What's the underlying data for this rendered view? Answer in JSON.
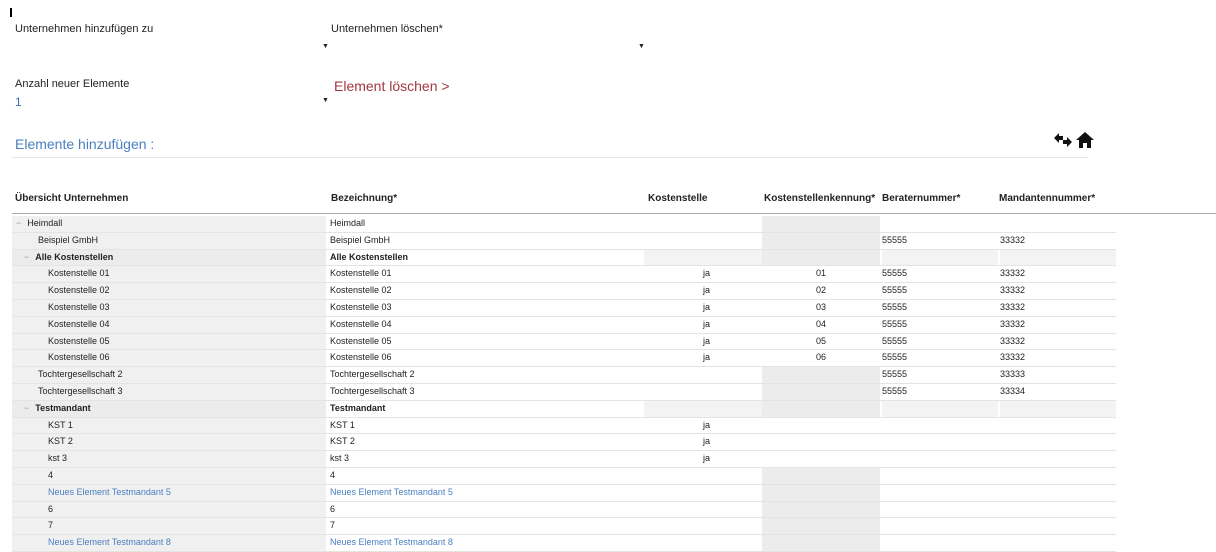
{
  "form": {
    "add_company_label": "Unternehmen hinzufügen zu",
    "delete_company_label": "Unternehmen löschen*",
    "count_label": "Anzahl neuer Elemente",
    "count_value": "1",
    "delete_element_link": "Element löschen >",
    "add_elements_link": "Elemente hinzufügen :",
    "dropdown_arrow": "▼"
  },
  "toolbar": {
    "swap_icon": "swap-arrows-icon",
    "home_icon": "home-icon",
    "swap_glyph": "⇅",
    "home_glyph": "⌂"
  },
  "table": {
    "headers": {
      "overview": "Übersicht Unternehmen",
      "bezeichnung": "Bezeichnung*",
      "kostenstelle": "Kostenstelle",
      "kennung": "Kostenstellenkennung*",
      "berater": "Beraternummer*",
      "mandant": "Mandantennummer*"
    },
    "rows": [
      {
        "name": "Heimdall",
        "bez": "Heimdall",
        "kst": "",
        "kenn": "",
        "ber": "",
        "man": ""
      },
      {
        "name": "Beispiel GmbH",
        "bez": "Beispiel GmbH",
        "kst": "",
        "kenn": "",
        "ber": "55555",
        "man": "33332"
      },
      {
        "name": "Alle Kostenstellen",
        "bez": "Alle Kostenstellen",
        "kst": "",
        "kenn": "",
        "ber": "",
        "man": ""
      },
      {
        "name": "Kostenstelle 01",
        "bez": "Kostenstelle 01",
        "kst": "ja",
        "kenn": "01",
        "ber": "55555",
        "man": "33332"
      },
      {
        "name": "Kostenstelle 02",
        "bez": "Kostenstelle 02",
        "kst": "ja",
        "kenn": "02",
        "ber": "55555",
        "man": "33332"
      },
      {
        "name": "Kostenstelle 03",
        "bez": "Kostenstelle 03",
        "kst": "ja",
        "kenn": "03",
        "ber": "55555",
        "man": "33332"
      },
      {
        "name": "Kostenstelle 04",
        "bez": "Kostenstelle 04",
        "kst": "ja",
        "kenn": "04",
        "ber": "55555",
        "man": "33332"
      },
      {
        "name": "Kostenstelle 05",
        "bez": "Kostenstelle 05",
        "kst": "ja",
        "kenn": "05",
        "ber": "55555",
        "man": "33332"
      },
      {
        "name": "Kostenstelle 06",
        "bez": "Kostenstelle 06",
        "kst": "ja",
        "kenn": "06",
        "ber": "55555",
        "man": "33332"
      },
      {
        "name": "Tochtergesellschaft 2",
        "bez": "Tochtergesellschaft 2",
        "kst": "",
        "kenn": "",
        "ber": "55555",
        "man": "33333"
      },
      {
        "name": "Tochtergesellschaft 3",
        "bez": "Tochtergesellschaft 3",
        "kst": "",
        "kenn": "",
        "ber": "55555",
        "man": "33334"
      },
      {
        "name": "Testmandant",
        "bez": "Testmandant",
        "kst": "",
        "kenn": "",
        "ber": "",
        "man": ""
      },
      {
        "name": "KST 1",
        "bez": "KST 1",
        "kst": "ja",
        "kenn": "",
        "ber": "",
        "man": ""
      },
      {
        "name": "KST 2",
        "bez": "KST 2",
        "kst": "ja",
        "kenn": "",
        "ber": "",
        "man": ""
      },
      {
        "name": "kst 3",
        "bez": "kst 3",
        "kst": "ja",
        "kenn": "",
        "ber": "",
        "man": ""
      },
      {
        "name": "4",
        "bez": "4",
        "kst": "",
        "kenn": "",
        "ber": "",
        "man": ""
      },
      {
        "name": "Neues Element Testmandant 5",
        "bez": "Neues Element Testmandant 5",
        "kst": "",
        "kenn": "",
        "ber": "",
        "man": ""
      },
      {
        "name": "6",
        "bez": "6",
        "kst": "",
        "kenn": "",
        "ber": "",
        "man": ""
      },
      {
        "name": "7",
        "bez": "7",
        "kst": "",
        "kenn": "",
        "ber": "",
        "man": ""
      },
      {
        "name": "Neues Element Testmandant 8",
        "bez": "Neues Element Testmandant 8",
        "kst": "",
        "kenn": "",
        "ber": "",
        "man": ""
      }
    ]
  },
  "colors": {
    "link_blue": "#4a7fc1",
    "delete_red": "#a0383f",
    "cell_gray": "#ececec"
  }
}
